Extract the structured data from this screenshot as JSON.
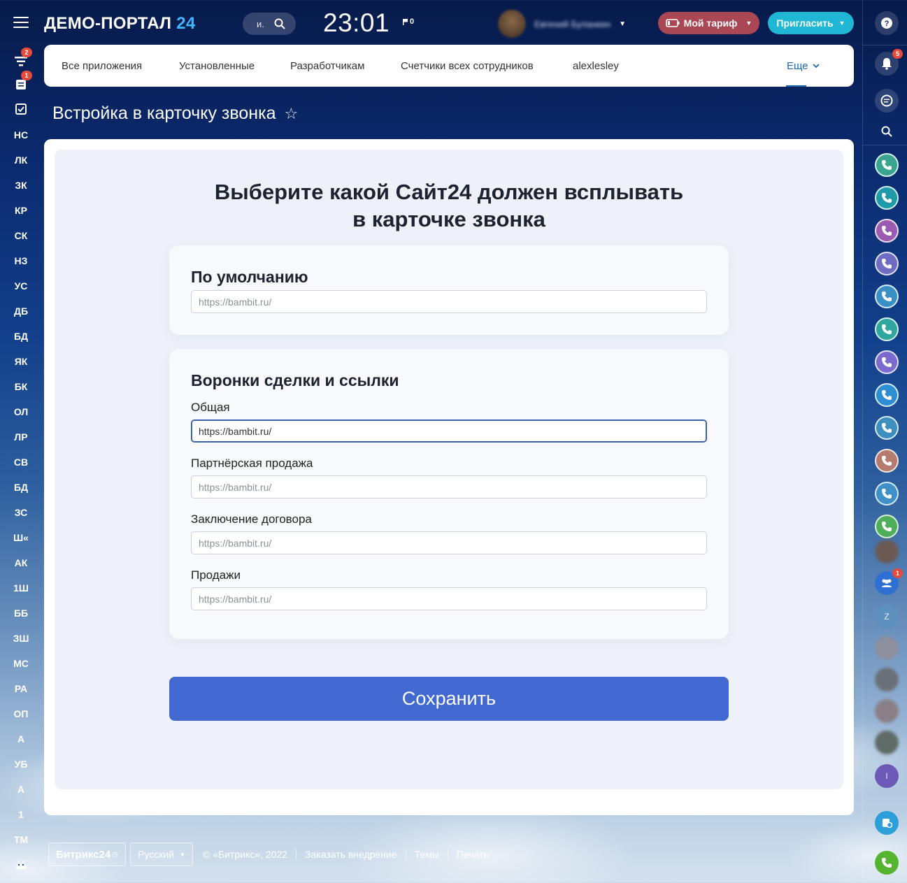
{
  "header": {
    "logo_text": "ДЕМО-ПОРТАЛ",
    "logo_num": "24",
    "search_placeholder": "и.",
    "clock": "23:01",
    "flag_count": "0",
    "user_name": "Евгений Буланкин",
    "tariff_label": "Мой тариф",
    "invite_label": "Пригласить"
  },
  "left_rail": {
    "badges": {
      "feed": "2",
      "tasks": "1"
    },
    "items": [
      "НС",
      "ЛК",
      "ЗК",
      "КР",
      "СК",
      "НЗ",
      "УС",
      "ДБ",
      "БД",
      "ЯК",
      "БК",
      "ОЛ",
      "ЛР",
      "СВ",
      "БД",
      "ЗС",
      "Ш«",
      "АК",
      "1Ш",
      "ББ",
      "ЗШ",
      "МС",
      "РА",
      "ОП",
      "А",
      "УБ",
      "А",
      "1",
      "ТМ"
    ]
  },
  "topnav": {
    "items": [
      "Все приложения",
      "Установленные",
      "Разработчикам",
      "Счетчики всех сотрудников",
      "alexlesley"
    ],
    "more_label": "Еще"
  },
  "page_title": "Встройка в карточку звонка",
  "form": {
    "headline_line1": "Выберите какой Сайт24 должен всплывать",
    "headline_line2": "в карточке звонка",
    "default_section_title": "По умолчанию",
    "default_placeholder": "https://bambit.ru/",
    "funnels_section_title": "Воронки сделки и ссылки",
    "funnels": [
      {
        "label": "Общая",
        "value": "https://bambit.ru/",
        "placeholder": "https://bambit.ru/"
      },
      {
        "label": "Партнёрская продажа",
        "value": "",
        "placeholder": "https://bambit.ru/"
      },
      {
        "label": "Заключение договора",
        "value": "",
        "placeholder": "https://bambit.ru/"
      },
      {
        "label": "Продажи",
        "value": "",
        "placeholder": "https://bambit.ru/"
      }
    ],
    "save_label": "Сохранить"
  },
  "footer": {
    "brand": "Битрикс24",
    "language": "Русский",
    "copyright": "© «Битрикс», 2022",
    "links": [
      "Заказать внедрение",
      "Темы",
      "Печать"
    ]
  },
  "right_rail": {
    "notif_badge": "5",
    "chat_badge": "1",
    "letter_z": "Z",
    "letter_i": "I",
    "phone_colors": [
      "#3aa58f",
      "#1f9aa8",
      "#9a5bb0",
      "#6f6cc4",
      "#3a8fc4",
      "#2fa7a0",
      "#7b6bd0",
      "#2d8fd2",
      "#3d8fc0",
      "#b57a70",
      "#3f8fc8",
      "#4fae5a"
    ]
  },
  "colors": {
    "accent": "#4169cf",
    "tariff": "#a94754",
    "invite": "#1fb7d4",
    "link": "#2067b0",
    "call": "#55b530"
  }
}
